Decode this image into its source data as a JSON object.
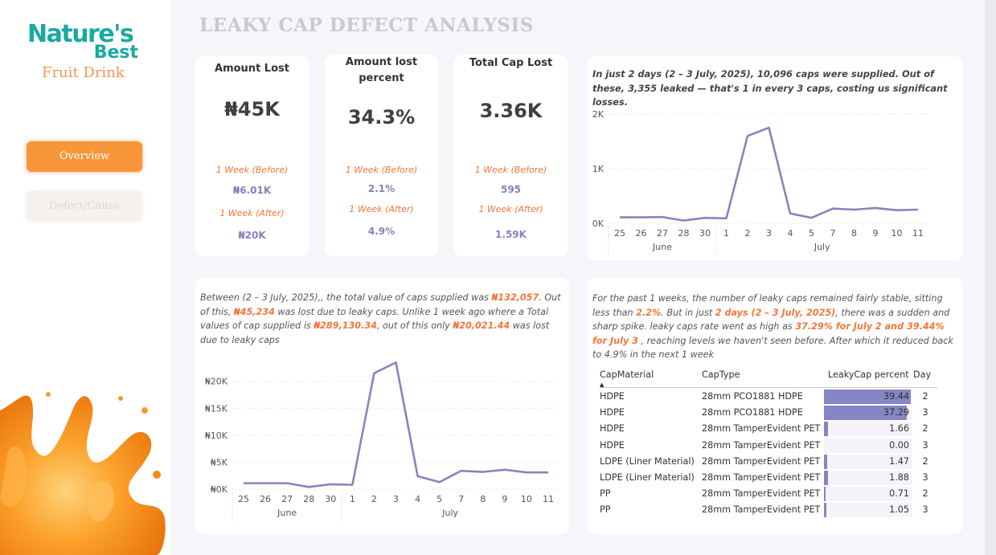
{
  "brand": {
    "name_line1": "Nature's",
    "name_line2": "Best",
    "subtitle": "Fruit Drink"
  },
  "nav": {
    "overview": "Overview",
    "defect_cause": "Defect/Cause"
  },
  "page_title": "LEAKY CAP DEFECT ANALYSIS",
  "kpis": [
    {
      "title": "Amount Lost",
      "value": "₦45K",
      "before_label": "1 Week (Before)",
      "before_value": "₦6.01K",
      "after_label": "1 Week (After)",
      "after_value": "₦20K"
    },
    {
      "title": "Amount lost percent",
      "value": "34.3%",
      "before_label": "1 Week (Before)",
      "before_value": "2.1%",
      "after_label": "1 Week (After)",
      "after_value": "4.9%"
    },
    {
      "title": "Total Cap Lost",
      "value": "3.36K",
      "before_label": "1 Week (Before)",
      "before_value": "595",
      "after_label": "1 Week (After)",
      "after_value": "1.59K"
    }
  ],
  "notes": {
    "caps_summary": "In just 2 days (2 –  3 July, 2025), 10,096 caps were supplied. Out of these, 3,355 leaked — that's 1 in every 3 caps, costing us significant losses.",
    "value_p1": "Between (2 –  3 July, 2025),, the total value of caps supplied was ",
    "value_h1": "₦132,057",
    "value_p2": ". Out of this, ",
    "value_h2": "₦45,234",
    "value_p3": " was lost due to leaky caps. Unlike 1 week ago where a Total values of cap supplied is  ",
    "value_h3": "₦289,130.34",
    "value_p4": ", out of this only ",
    "value_h4": "₦20,021.44",
    "value_p5": " was lost due to leaky caps",
    "trend_p1": "For the past 1 weeks, the number of leaky caps remained fairly stable, sitting less than ",
    "trend_h1": "2.2%",
    "trend_p2": ". But in just ",
    "trend_h2": "2 days (2 –  3 July, 2025)",
    "trend_p3": ", there was a sudden and sharp spike. leaky caps rate went as high as ",
    "trend_h3": "37.29% for July 2 and 39.44% for July 3",
    "trend_p4": " , reaching levels we haven't seen before. After which it reduced back to 4.9% in the next 1 week"
  },
  "chart_data": [
    {
      "type": "line",
      "categories": [
        "25",
        "26",
        "27",
        "28",
        "30",
        "1",
        "2",
        "3",
        "4",
        "5",
        "7",
        "8",
        "9",
        "10",
        "11"
      ],
      "month_labels": [
        "June",
        "July"
      ],
      "values": [
        110,
        110,
        115,
        50,
        100,
        90,
        1600,
        1750,
        180,
        100,
        270,
        250,
        280,
        240,
        250
      ],
      "ytick_labels": [
        "0K",
        "1K",
        "2K"
      ],
      "ylim": [
        0,
        2000
      ],
      "series_color": "#8585c2",
      "grid": "dotted horizontal"
    },
    {
      "type": "line",
      "categories": [
        "25",
        "26",
        "27",
        "28",
        "30",
        "1",
        "2",
        "3",
        "4",
        "5",
        "7",
        "8",
        "9",
        "10",
        "11"
      ],
      "month_labels": [
        "June",
        "July"
      ],
      "values": [
        1100,
        1100,
        1100,
        400,
        900,
        800,
        21500,
        23500,
        2400,
        1300,
        3400,
        3200,
        3600,
        3100,
        3100
      ],
      "ytick_labels": [
        "₦0K",
        "₦5K",
        "₦10K",
        "₦15K",
        "₦20K"
      ],
      "ylim": [
        0,
        22000
      ],
      "series_color": "#8585c2",
      "grid": "dotted horizontal"
    }
  ],
  "table": {
    "headers": [
      "CapMaterial",
      "CapType",
      "LeakyCap percent",
      "Day"
    ],
    "sort_indicator": "▲",
    "rows": [
      {
        "material": "HDPE",
        "type": "28mm PCO1881 HDPE",
        "pct": "39.44",
        "pct_val": 39.44,
        "day": "2"
      },
      {
        "material": "HDPE",
        "type": "28mm PCO1881 HDPE",
        "pct": "37.29",
        "pct_val": 37.29,
        "day": "3"
      },
      {
        "material": "HDPE",
        "type": "28mm TamperEvident PET",
        "pct": "1.66",
        "pct_val": 1.66,
        "day": "2"
      },
      {
        "material": "HDPE",
        "type": "28mm TamperEvident PET",
        "pct": "0.00",
        "pct_val": 0.0,
        "day": "3"
      },
      {
        "material": "LDPE (Liner Material)",
        "type": "28mm TamperEvident PET",
        "pct": "1.47",
        "pct_val": 1.47,
        "day": "2"
      },
      {
        "material": "LDPE (Liner Material)",
        "type": "28mm TamperEvident PET",
        "pct": "1.88",
        "pct_val": 1.88,
        "day": "3"
      },
      {
        "material": "PP",
        "type": "28mm TamperEvident PET",
        "pct": "0.71",
        "pct_val": 0.71,
        "day": "2"
      },
      {
        "material": "PP",
        "type": "28mm TamperEvident PET",
        "pct": "1.05",
        "pct_val": 1.05,
        "day": "3"
      }
    ]
  }
}
